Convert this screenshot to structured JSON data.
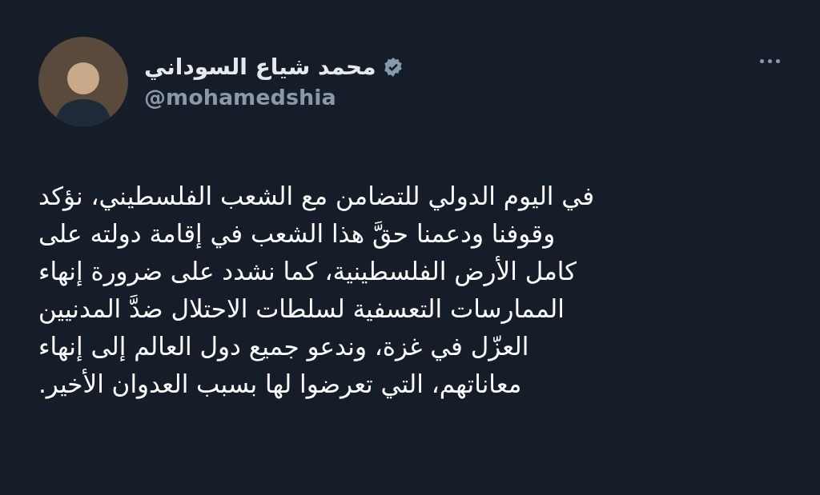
{
  "author": {
    "name": "محمد شياع السوداني",
    "handle": "@mohamedshia",
    "verified": true
  },
  "tweet": {
    "lines": [
      "في اليوم الدولي للتضامن مع الشعب الفلسطيني، نؤكد",
      "وقوفنا ودعمنا حقَّ هذا الشعب في إقامة دولته على",
      "كامل الأرض الفلسطينية، كما نشدد على ضرورة إنهاء",
      "الممارسات التعسفية لسلطات الاحتلال ضدَّ المدنيين",
      "العزّل في غزة، وندعو جميع دول العالم إلى إنهاء",
      "معاناتهم، التي تعرضوا لها بسبب العدوان الأخير."
    ]
  }
}
